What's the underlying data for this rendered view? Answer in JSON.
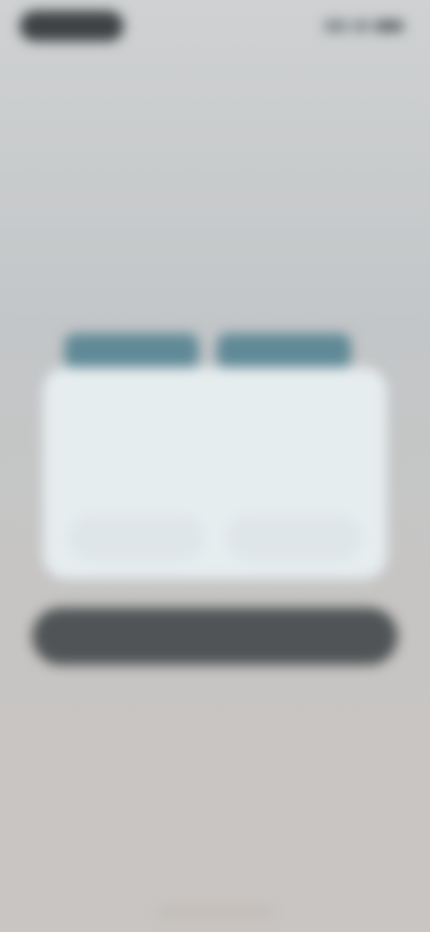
{
  "status_bar": {
    "pill_text": "",
    "icons": [
      "signal-icon",
      "wifi-icon",
      "battery-icon"
    ]
  },
  "hero": {
    "title": "",
    "subtitle": "",
    "mark": "",
    "caption": "",
    "tabs": [
      "",
      ""
    ]
  },
  "dialog": {
    "title": "",
    "body": "",
    "left_button": "",
    "right_button": ""
  },
  "primary_button": {
    "label": ""
  },
  "secondary_link": {
    "label": ""
  },
  "faint_link": {
    "label": ""
  },
  "footer": {
    "text": ""
  },
  "colors": {
    "accent": "#5f8996",
    "dialog_bg": "#e6edef",
    "primary_button_bg": "#505456",
    "page_bg": "#c7c8c8"
  }
}
